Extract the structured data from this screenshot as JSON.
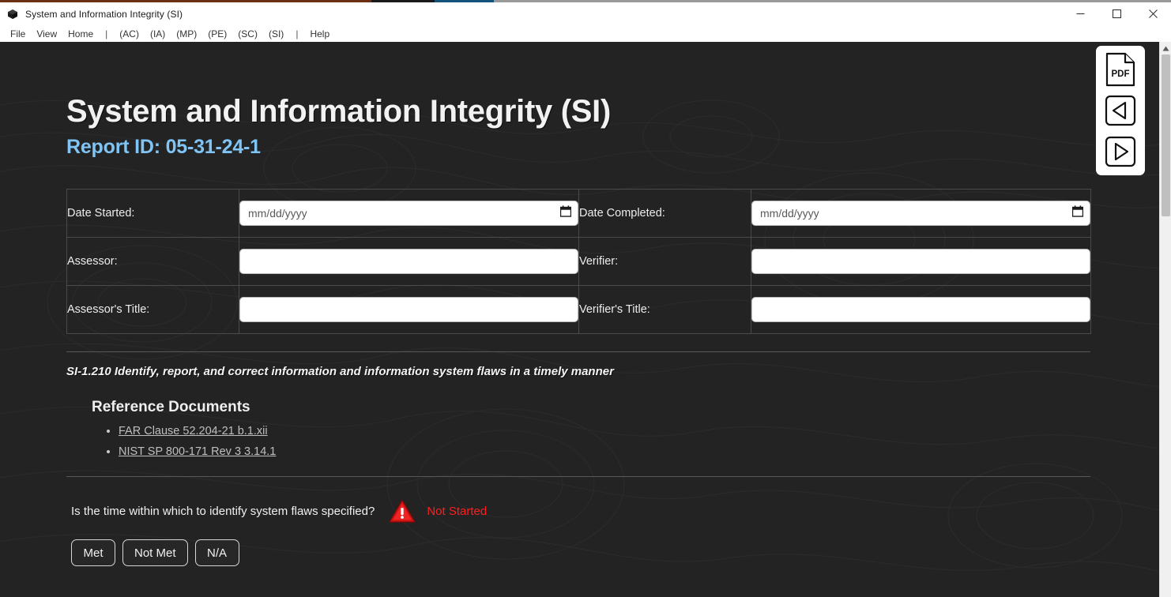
{
  "accent": {
    "brown": "#6d2f12",
    "blue": "#14517c",
    "gray": "#9a9a9a"
  },
  "titlebar": {
    "title": "System and Information Integrity (SI)",
    "icon": "cube-icon",
    "minimize_label": "–",
    "maximize_label": "☐",
    "close_label": "✕"
  },
  "menubar": {
    "items": [
      {
        "label": "File",
        "type": "menu"
      },
      {
        "label": "View",
        "type": "menu"
      },
      {
        "label": "Home",
        "type": "menu"
      },
      {
        "label": "|",
        "type": "separator"
      },
      {
        "label": "(AC)",
        "type": "menu"
      },
      {
        "label": "(IA)",
        "type": "menu"
      },
      {
        "label": "(MP)",
        "type": "menu"
      },
      {
        "label": "(PE)",
        "type": "menu"
      },
      {
        "label": "(SC)",
        "type": "menu"
      },
      {
        "label": "(SI)",
        "type": "menu"
      },
      {
        "label": "|",
        "type": "separator"
      },
      {
        "label": "Help",
        "type": "menu"
      }
    ]
  },
  "header": {
    "title": "System and Information Integrity (SI)",
    "report_id": "Report ID: 05-31-24-1",
    "report_id_color": "#7fc4f5"
  },
  "info_table": {
    "rows": [
      {
        "left_label": "Date Started:",
        "left_value": "",
        "left_placeholder": "mm/dd/yyyy",
        "left_type": "date",
        "right_label": "Date Completed:",
        "right_value": "",
        "right_placeholder": "mm/dd/yyyy",
        "right_type": "date"
      },
      {
        "left_label": "Assessor:",
        "left_value": "",
        "left_placeholder": "",
        "left_type": "text",
        "right_label": "Verifier:",
        "right_value": "",
        "right_placeholder": "",
        "right_type": "text"
      },
      {
        "left_label": "Assessor's Title:",
        "left_value": "",
        "left_placeholder": "",
        "left_type": "text",
        "right_label": "Verifier's Title:",
        "right_value": "",
        "right_placeholder": "",
        "right_type": "text"
      }
    ]
  },
  "control": {
    "statement": "SI-1.210 Identify, report, and correct information and information system flaws in a timely manner"
  },
  "references": {
    "heading": "Reference Documents",
    "links": [
      "FAR Clause 52.204-21 b.1.xii",
      "NIST SP 800-171 Rev 3 3.14.1"
    ]
  },
  "question": {
    "text": "Is the time within which to identify system flaws specified?",
    "status_icon": "warning-triangle-icon",
    "status_text": "Not Started",
    "status_color": "#ff1d1d",
    "answers": [
      "Met",
      "Not Met",
      "N/A"
    ]
  },
  "action_rail": {
    "buttons": [
      {
        "name": "pdf-button",
        "label": "PDF"
      },
      {
        "name": "previous-button",
        "label": "Previous"
      },
      {
        "name": "next-button",
        "label": "Next"
      }
    ]
  },
  "scrollbar": {
    "up_arrow": "▲",
    "down_arrow": "▼"
  }
}
